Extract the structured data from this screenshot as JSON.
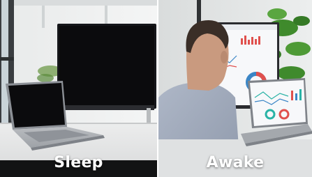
{
  "panels": {
    "left": {
      "caption": "Sleep",
      "state": "screens-off"
    },
    "right": {
      "caption": "Awake",
      "state": "screens-on"
    }
  },
  "colors": {
    "caption": "#ffffff",
    "screen_off": "#0b0b0d",
    "accent_red": "#e0504d",
    "accent_blue": "#3b86c6",
    "accent_teal": "#2ab3a6",
    "plant_green": "#3f8a2c"
  }
}
